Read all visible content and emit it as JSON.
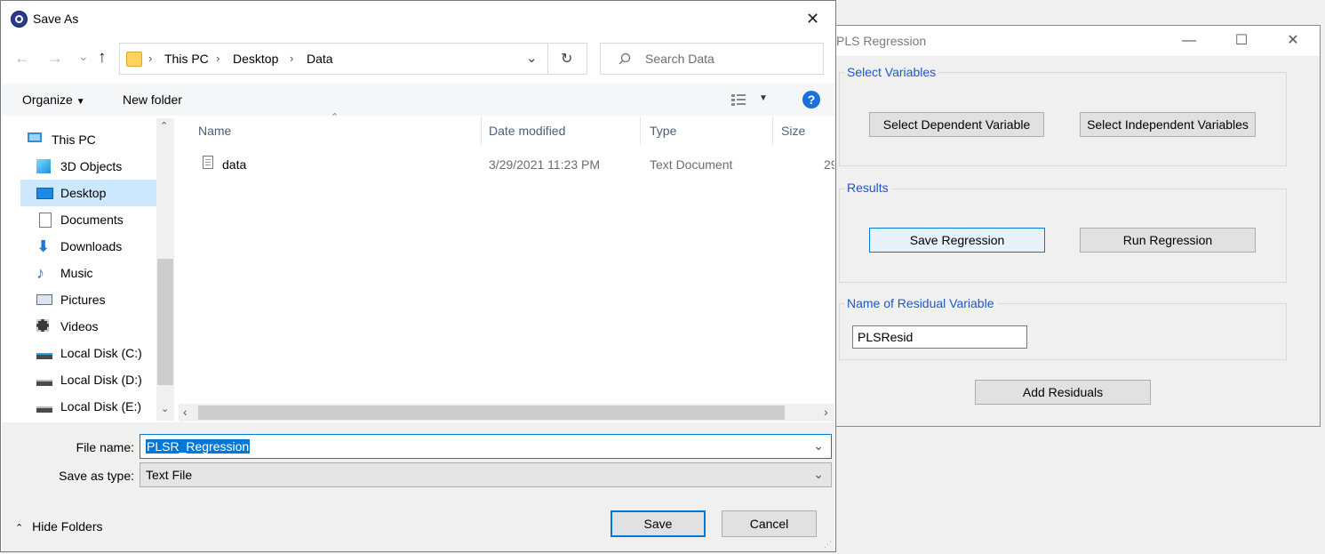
{
  "pls": {
    "title": "PLS Regression",
    "controls": {
      "minimize": "—",
      "maximize": "☐",
      "close": "✕"
    },
    "select_group": {
      "label": "Select Variables",
      "dependent_button": "Select Dependent Variable",
      "independent_button": "Select Independent Variables"
    },
    "results_group": {
      "label": "Results",
      "save_button": "Save Regression",
      "run_button": "Run Regression"
    },
    "residual_group": {
      "label": "Name of Residual Variable",
      "value": "PLSResid"
    },
    "add_residuals_button": "Add Residuals"
  },
  "dialog": {
    "title": "Save As",
    "close": "✕",
    "nav": {
      "back": "←",
      "forward": "→",
      "recent": "⌄",
      "up": "↑",
      "breadcrumb": [
        "This PC",
        "Desktop",
        "Data"
      ],
      "separator": "›",
      "dropdown": "⌄",
      "refresh": "↻",
      "search_placeholder": "Search Data"
    },
    "toolbar": {
      "organize": "Organize",
      "new_folder": "New folder",
      "help": "?"
    },
    "sidebar": [
      {
        "label": "This PC",
        "icon": "computer-icon"
      },
      {
        "label": "3D Objects",
        "icon": "cube-icon"
      },
      {
        "label": "Desktop",
        "icon": "desktop-icon"
      },
      {
        "label": "Documents",
        "icon": "documents-icon"
      },
      {
        "label": "Downloads",
        "icon": "download-icon"
      },
      {
        "label": "Music",
        "icon": "music-icon"
      },
      {
        "label": "Pictures",
        "icon": "pictures-icon"
      },
      {
        "label": "Videos",
        "icon": "videos-icon"
      },
      {
        "label": "Local Disk (C:)",
        "icon": "drive-icon"
      },
      {
        "label": "Local Disk (D:)",
        "icon": "drive-icon"
      },
      {
        "label": "Local Disk (E:)",
        "icon": "drive-icon"
      }
    ],
    "columns": {
      "name": "Name",
      "date": "Date modified",
      "type": "Type",
      "size": "Size"
    },
    "files": [
      {
        "name": "data",
        "date": "3/29/2021 11:23 PM",
        "type": "Text Document",
        "size": "29"
      }
    ],
    "file_name_label": "File name:",
    "file_name_value": "PLSR_Regression",
    "save_type_label": "Save as type:",
    "save_type_value": "Text File",
    "hide_folders": "Hide Folders",
    "save_button": "Save",
    "cancel_button": "Cancel"
  },
  "colors": {
    "accent": "#0078d7",
    "group_label": "#1a56d6",
    "selected_nav": "#cce8ff",
    "help_blue": "#1a6fd8"
  }
}
